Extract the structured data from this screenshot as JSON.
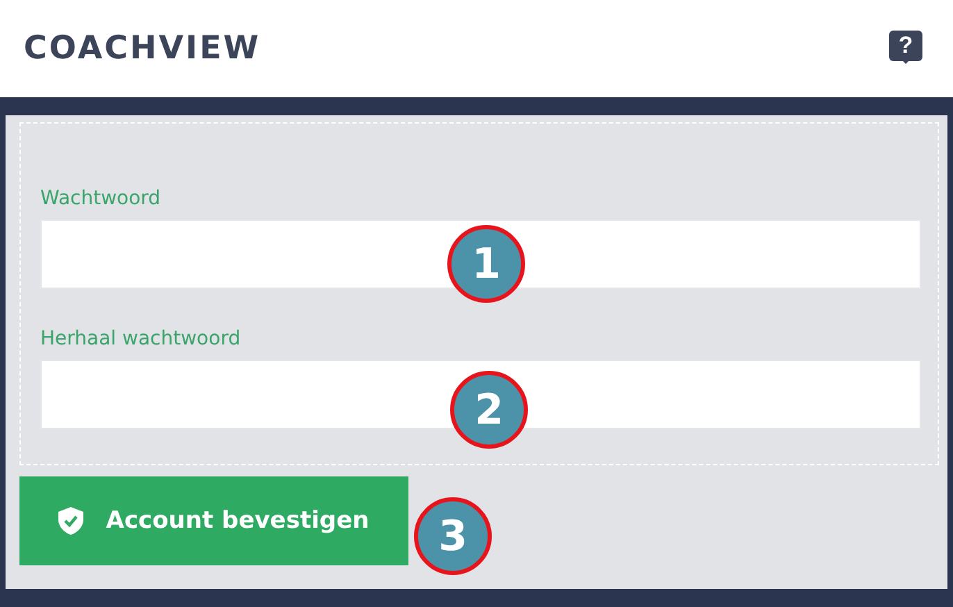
{
  "header": {
    "title": "COACHVIEW",
    "help_label": "?"
  },
  "fields": [
    {
      "label": "Wachtwoord"
    },
    {
      "label": "Herhaal wachtwoord"
    }
  ],
  "submit_button": {
    "label": "Account bevestigen"
  },
  "callouts": [
    {
      "label": "1"
    },
    {
      "label": "2"
    },
    {
      "label": "3"
    }
  ]
}
